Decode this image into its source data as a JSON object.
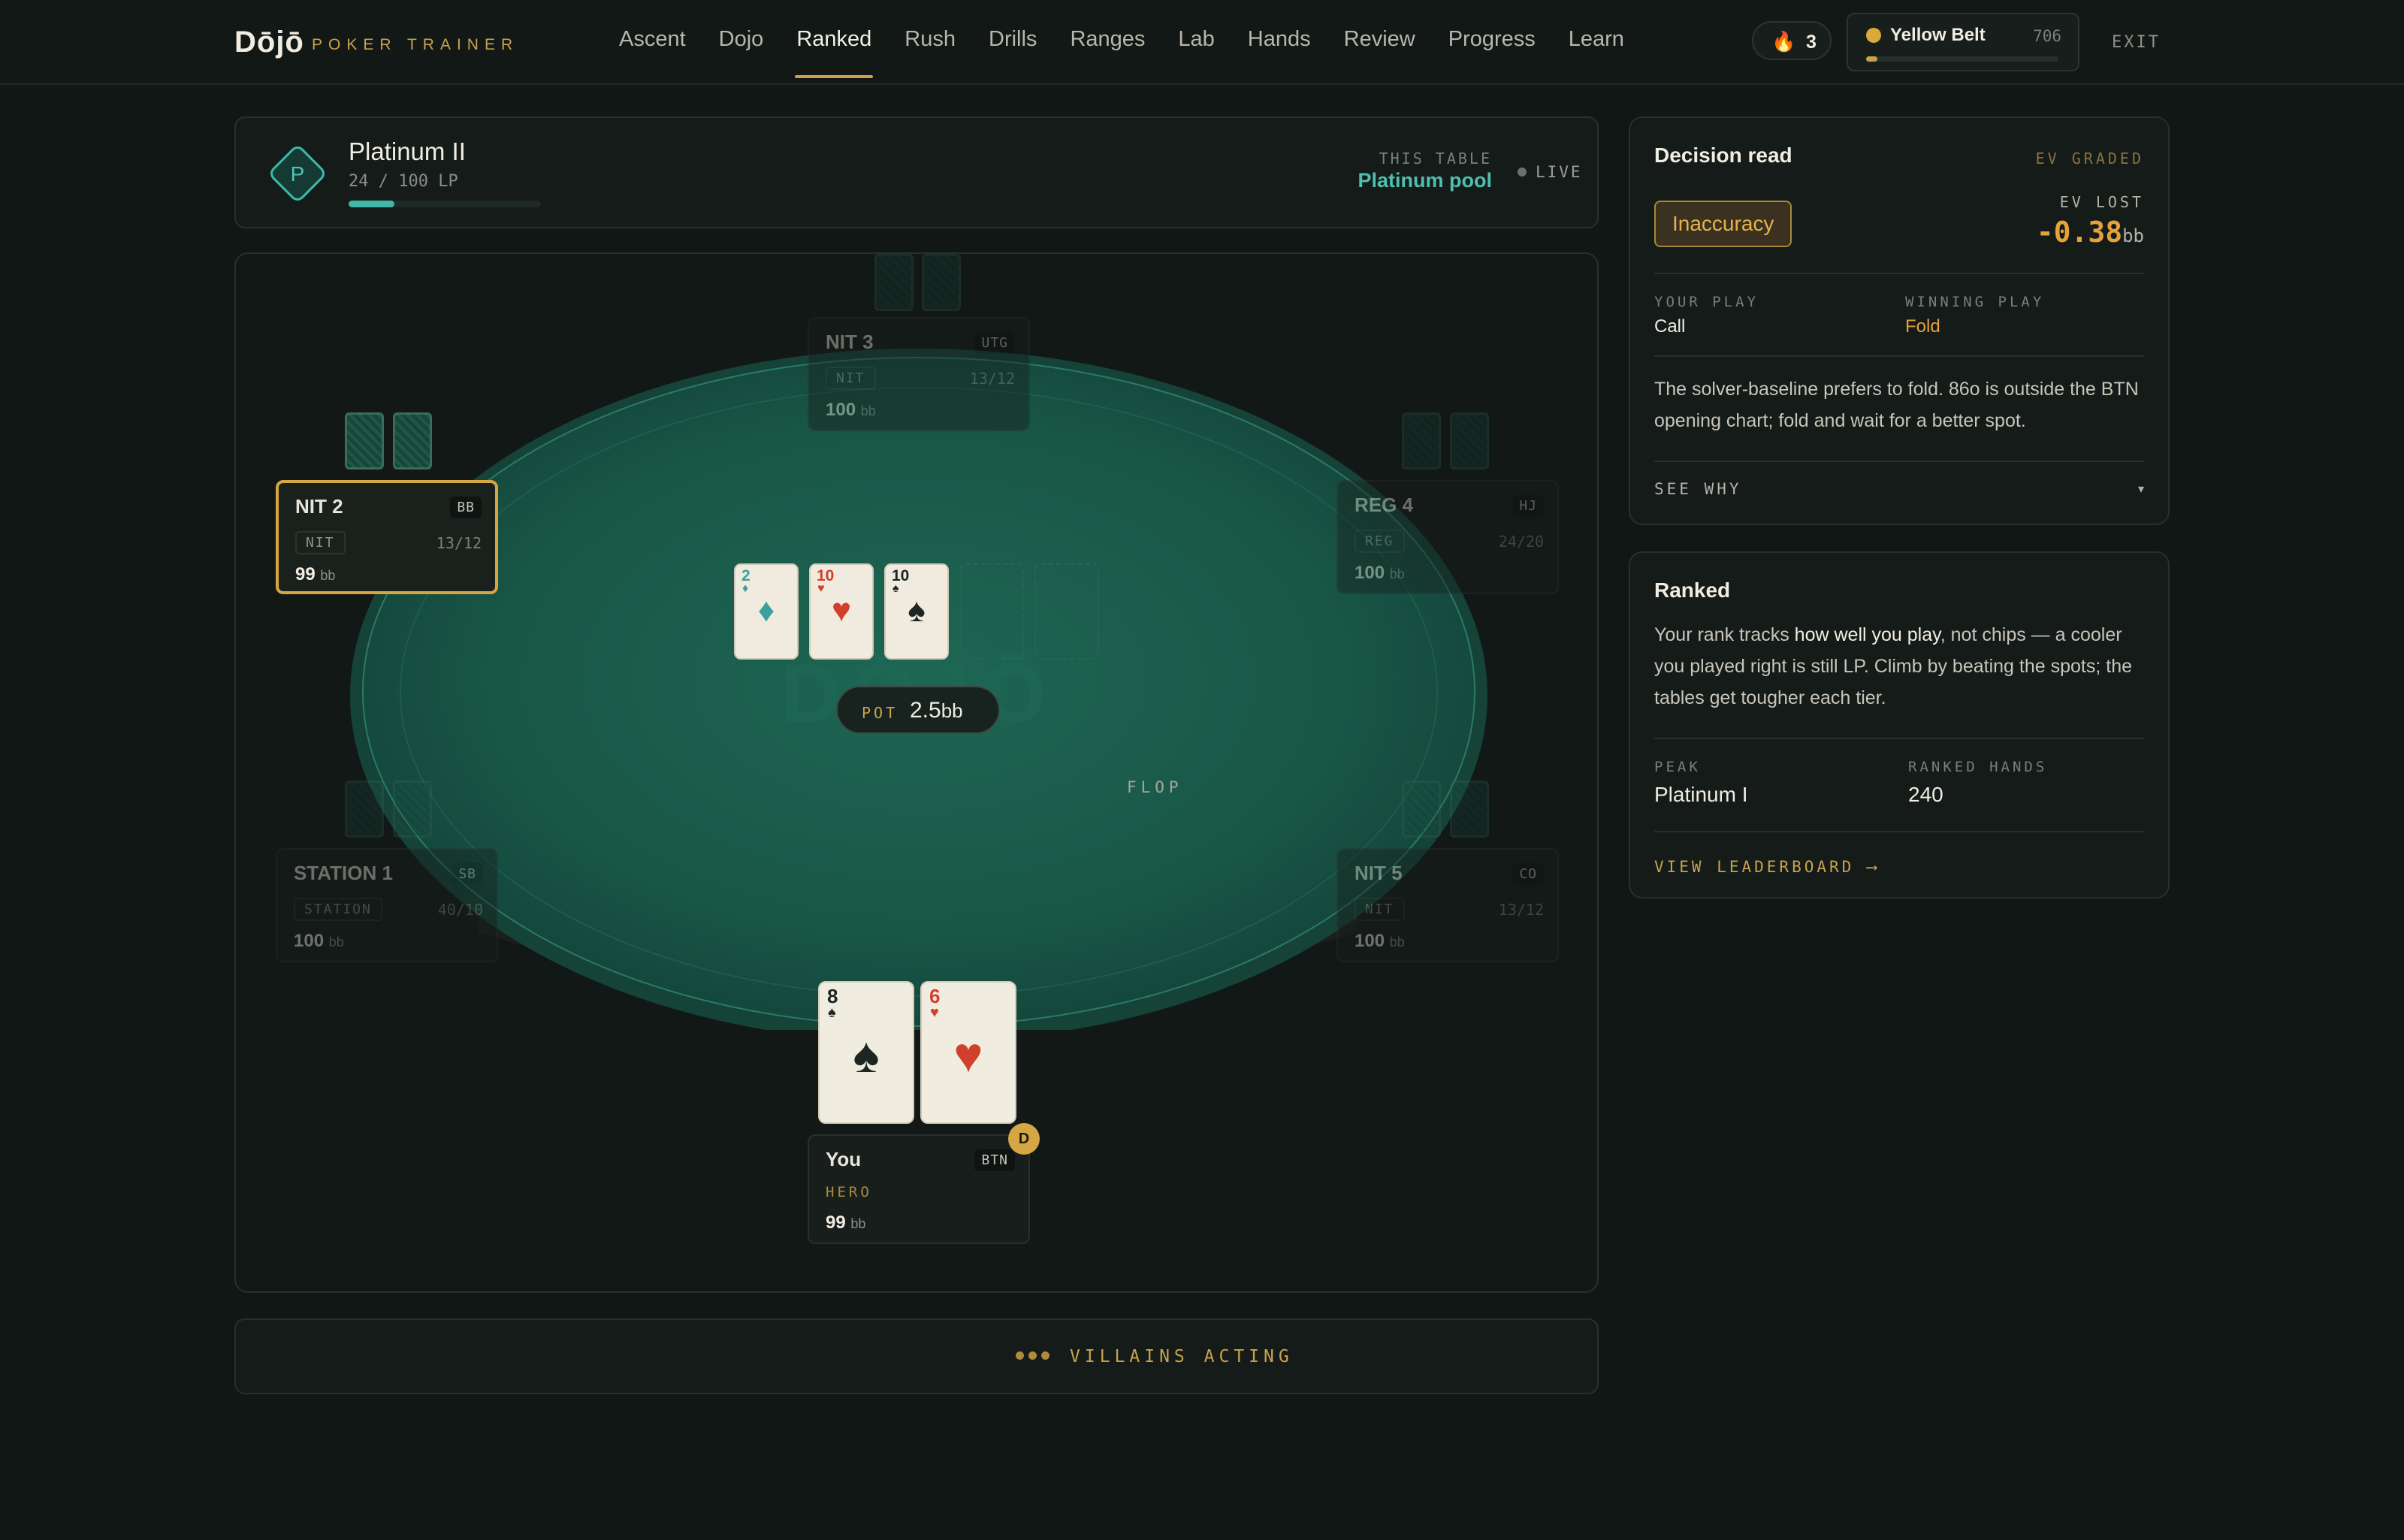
{
  "app": {
    "logo": "Dōjō",
    "subtitle": "POKER TRAINER"
  },
  "nav": {
    "items": [
      "Ascent",
      "Dojo",
      "Ranked",
      "Rush",
      "Drills",
      "Ranges",
      "Lab",
      "Hands",
      "Review",
      "Progress",
      "Learn"
    ],
    "active": "Ranked"
  },
  "header": {
    "streak": "3",
    "belt_name": "Yellow Belt",
    "belt_points": "706",
    "belt_progress": 0.06,
    "exit_label": "EXIT"
  },
  "rank": {
    "badge_letter": "P",
    "name": "Platinum II",
    "lp": "24 / 100 LP",
    "lp_progress": 0.24,
    "this_table_label": "THIS TABLE",
    "pool": "Platinum pool",
    "live_label": "LIVE"
  },
  "table": {
    "watermark": "DŌJŌ",
    "board_label": "FLOP",
    "board": [
      {
        "rank": "2",
        "suit": "♦",
        "color": "teal"
      },
      {
        "rank": "10",
        "suit": "♥",
        "color": "red"
      },
      {
        "rank": "10",
        "suit": "♠",
        "color": "black"
      }
    ],
    "pot_label": "POT",
    "pot_value": "2.5",
    "pot_unit": "bb",
    "seats": {
      "nit3": {
        "name": "NIT 3",
        "position": "UTG",
        "tag": "NIT",
        "stat": "13/12",
        "stack": "100",
        "unit": "bb"
      },
      "nit2": {
        "name": "NIT 2",
        "position": "BB",
        "tag": "NIT",
        "stat": "13/12",
        "stack": "99",
        "unit": "bb"
      },
      "reg4": {
        "name": "REG 4",
        "position": "HJ",
        "tag": "REG",
        "stat": "24/20",
        "stack": "100",
        "unit": "bb"
      },
      "station1": {
        "name": "STATION 1",
        "position": "SB",
        "tag": "STATION",
        "stat": "40/10",
        "stack": "100",
        "unit": "bb"
      },
      "nit5": {
        "name": "NIT 5",
        "position": "CO",
        "tag": "NIT",
        "stat": "13/12",
        "stack": "100",
        "unit": "bb"
      },
      "hero": {
        "name": "You",
        "position": "BTN",
        "tag": "HERO",
        "stack": "99",
        "unit": "bb",
        "dealer": "D"
      }
    },
    "hero_cards": [
      {
        "rank": "8",
        "suit": "♠",
        "color": "black"
      },
      {
        "rank": "6",
        "suit": "♥",
        "color": "red"
      }
    ]
  },
  "status": {
    "text": "VILLAINS ACTING"
  },
  "decision": {
    "title": "Decision read",
    "graded_label": "EV GRADED",
    "verdict": "Inaccuracy",
    "ev_lost_label": "EV LOST",
    "ev_lost_value": "-0.38",
    "ev_lost_unit": "bb",
    "your_play_label": "YOUR PLAY",
    "your_play": "Call",
    "winning_play_label": "WINNING PLAY",
    "winning_play": "Fold",
    "explanation": "The solver-baseline prefers to fold. 86o is outside the BTN opening chart; fold and wait for a better spot.",
    "see_why": "SEE WHY"
  },
  "ranked": {
    "title": "Ranked",
    "desc_pre": "Your rank tracks ",
    "desc_em": "how well you play",
    "desc_post": ", not chips — a cooler you played right is still LP. Climb by beating the spots; the tables get tougher each tier.",
    "peak_label": "PEAK",
    "peak_value": "Platinum I",
    "hands_label": "RANKED HANDS",
    "hands_value": "240",
    "leaderboard_label": "VIEW LEADERBOARD ⟶"
  },
  "colors": {
    "accent_gold": "#c9a24b",
    "accent_teal": "#3fb8aa",
    "felt": "#1b5e4d",
    "background": "#111715",
    "ev_loss": "#e5a23a"
  },
  "icons": [
    "flame-icon",
    "belt-dot-icon",
    "rank-diamond-icon",
    "live-dot-icon",
    "chevron-down-icon",
    "dealer-button-icon",
    "arrow-right-icon"
  ]
}
